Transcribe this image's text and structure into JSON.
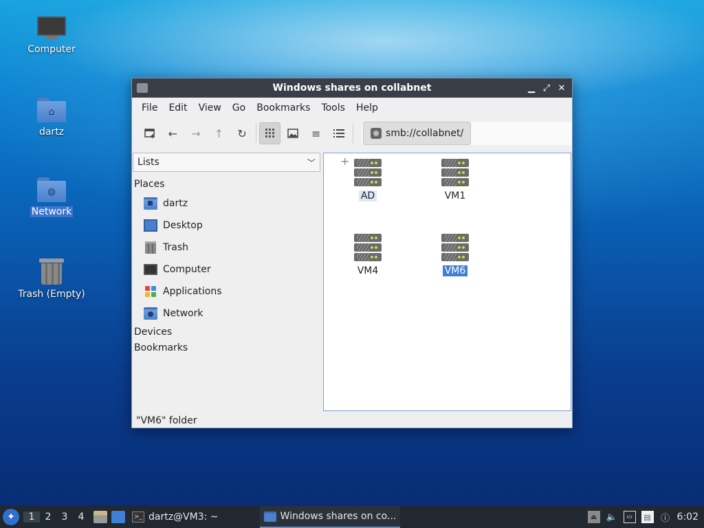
{
  "desktop": {
    "icons": [
      {
        "label": "Computer",
        "icon": "computer-icon"
      },
      {
        "label": "dartz",
        "icon": "home-folder-icon"
      },
      {
        "label": "Network",
        "icon": "network-folder-icon"
      },
      {
        "label": "Trash (Empty)",
        "icon": "trash-icon"
      }
    ]
  },
  "window": {
    "title": "Windows shares on collabnet",
    "menu": [
      "File",
      "Edit",
      "View",
      "Go",
      "Bookmarks",
      "Tools",
      "Help"
    ],
    "path": "smb://collabnet/",
    "side_select": "Lists",
    "sections": {
      "places": "Places",
      "devices": "Devices",
      "bookmarks": "Bookmarks"
    },
    "places": [
      {
        "label": "dartz",
        "icon": "home-folder-icon"
      },
      {
        "label": "Desktop",
        "icon": "desktop-icon"
      },
      {
        "label": "Trash",
        "icon": "trash-icon"
      },
      {
        "label": "Computer",
        "icon": "computer-icon"
      },
      {
        "label": "Applications",
        "icon": "applications-icon"
      },
      {
        "label": "Network",
        "icon": "network-folder-icon"
      }
    ],
    "items": [
      {
        "name": "AD",
        "state": "hover"
      },
      {
        "name": "VM1",
        "state": "normal"
      },
      {
        "name": "VM4",
        "state": "normal"
      },
      {
        "name": "VM6",
        "state": "selected"
      }
    ],
    "status": "\"VM6\" folder"
  },
  "taskbar": {
    "workspaces": [
      "1",
      "2",
      "3",
      "4"
    ],
    "tasks": [
      {
        "label": "dartz@VM3: ~"
      },
      {
        "label": "Windows shares on co..."
      }
    ],
    "clock": "6:02"
  }
}
